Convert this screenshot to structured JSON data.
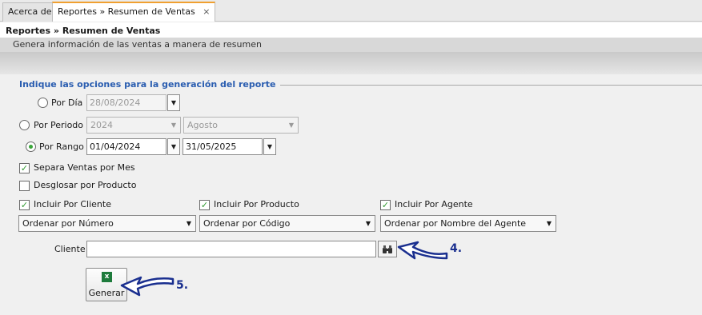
{
  "tabs": [
    {
      "label": "Acerca de"
    },
    {
      "label": "Reportes » Resumen de Ventas",
      "close": "×"
    }
  ],
  "header": {
    "title": "Reportes » Resumen de Ventas",
    "subtitle": "Genera información de las ventas a manera de resumen"
  },
  "options": {
    "section_title": "Indique las opciones para la generación del reporte",
    "por_dia": {
      "label": "Por Día",
      "date": "28/08/2024",
      "selected": false
    },
    "por_periodo": {
      "label": "Por Periodo",
      "year": "2024",
      "month": "Agosto",
      "selected": false
    },
    "por_rango": {
      "label": "Por Rango",
      "from": "01/04/2024",
      "to": "31/05/2025",
      "selected": true
    },
    "separa_ventas": {
      "label": "Separa Ventas por Mes",
      "checked": true
    },
    "desglosar": {
      "label": "Desglosar por Producto",
      "checked": false
    },
    "incluir_cliente": {
      "label": "Incluir Por Cliente",
      "checked": true
    },
    "incluir_producto": {
      "label": "Incluir Por Producto",
      "checked": true
    },
    "incluir_agente": {
      "label": "Incluir Por Agente",
      "checked": true
    },
    "ordenar_cliente": "Ordenar por Número",
    "ordenar_producto": "Ordenar por Código",
    "ordenar_agente": "Ordenar por Nombre del Agente",
    "cliente_label": "Cliente",
    "cliente_value": "",
    "generar_label": "Generar"
  },
  "annotations": {
    "callout_4": "4.",
    "callout_5": "5.",
    "arrow_color": "#1a2f8f"
  },
  "icons": {
    "search": "binoculars-icon",
    "generar": "excel-icon",
    "dropdown": "chevron-down-icon"
  },
  "colors": {
    "accent_tab": "#f0a030",
    "section_title": "#2a5db0",
    "check": "#2f9a2f"
  }
}
